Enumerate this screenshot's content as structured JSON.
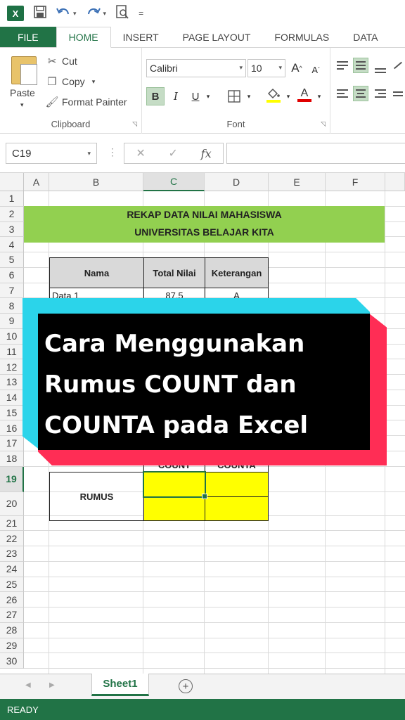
{
  "qat": {
    "logo": "X",
    "icons": [
      "save-icon",
      "undo-icon",
      "redo-icon",
      "print-preview-icon",
      "customize-icon"
    ]
  },
  "tabs": [
    {
      "label": "FILE"
    },
    {
      "label": "HOME"
    },
    {
      "label": "INSERT"
    },
    {
      "label": "PAGE LAYOUT"
    },
    {
      "label": "FORMULAS"
    },
    {
      "label": "DATA"
    }
  ],
  "clipboard": {
    "paste": "Paste",
    "cut": "Cut",
    "copy": "Copy",
    "format_painter": "Format Painter",
    "group_label": "Clipboard"
  },
  "font": {
    "name": "Calibri",
    "size": "10",
    "grow": "A",
    "shrink": "A",
    "bold": "B",
    "italic": "I",
    "underline": "U",
    "font_color_glyph": "A",
    "group_label": "Font"
  },
  "formula_bar": {
    "name_box": "C19",
    "dots": "⋮",
    "cancel": "✕",
    "enter": "✓",
    "fx": "fx",
    "value": ""
  },
  "columns": [
    "A",
    "B",
    "C",
    "D",
    "E",
    "F"
  ],
  "selected_column": "C",
  "rows": [
    "1",
    "2",
    "3",
    "4",
    "5",
    "6",
    "7",
    "8",
    "9",
    "10",
    "11",
    "12",
    "13",
    "14",
    "15",
    "16",
    "17",
    "18",
    "19",
    "20",
    "21",
    "22",
    "23",
    "24",
    "25",
    "26",
    "27",
    "28",
    "29",
    "30"
  ],
  "selected_row": "19",
  "sheet": {
    "title_line1": "REKAP DATA NILAI MAHASISWA",
    "title_line2": "UNIVERSITAS BELAJAR KITA",
    "table_headers": [
      "Nama",
      "Total Nilai",
      "Keterangan"
    ],
    "row7": [
      "Data 1",
      "87,5",
      "A"
    ],
    "row18": [
      "COUNT",
      "COUNTA"
    ],
    "rumus_label": "RUMUS"
  },
  "overlay": {
    "line1": "Cara Menggunakan",
    "line2": "Rumus COUNT dan",
    "line3": "COUNTA pada Excel",
    "colors": {
      "cyan": "#2bd4ea",
      "red": "#ff2d55",
      "black": "#000000"
    }
  },
  "sheet_tabs": {
    "active": "Sheet1",
    "add": "+"
  },
  "status_bar": {
    "text": "READY"
  },
  "colors": {
    "excel_green": "#217346",
    "banner_green": "#92d050",
    "highlight_yellow": "#ffff00",
    "header_gray": "#d9d9d9"
  }
}
